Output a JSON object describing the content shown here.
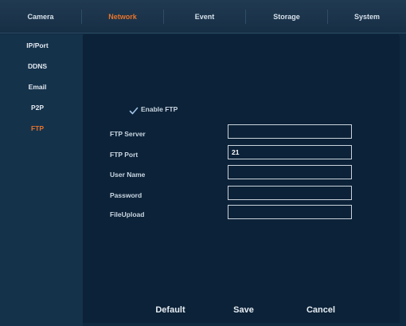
{
  "tabs": [
    {
      "label": "Camera",
      "active": false
    },
    {
      "label": "Network",
      "active": true
    },
    {
      "label": "Event",
      "active": false
    },
    {
      "label": "Storage",
      "active": false
    },
    {
      "label": "System",
      "active": false
    }
  ],
  "sidebar": {
    "items": [
      {
        "label": "IP/Port",
        "active": false
      },
      {
        "label": "DDNS",
        "active": false
      },
      {
        "label": "Email",
        "active": false
      },
      {
        "label": "P2P",
        "active": false
      },
      {
        "label": "FTP",
        "active": true
      }
    ]
  },
  "ftp": {
    "enable_label": "Enable FTP",
    "enabled": true,
    "check_icon": "checkmark-icon",
    "fields": [
      {
        "label": "FTP Server",
        "value": ""
      },
      {
        "label": "FTP Port",
        "value": "21"
      },
      {
        "label": "User Name",
        "value": ""
      },
      {
        "label": "Password",
        "value": ""
      },
      {
        "label": "FileUpload",
        "value": ""
      }
    ]
  },
  "buttons": {
    "default_label": "Default",
    "save_label": "Save",
    "cancel_label": "Cancel"
  },
  "colors": {
    "active_accent": "#e8732a",
    "background": "#0f2a40",
    "panel": "#0c2238",
    "checkmark": "#9fc3e6"
  }
}
